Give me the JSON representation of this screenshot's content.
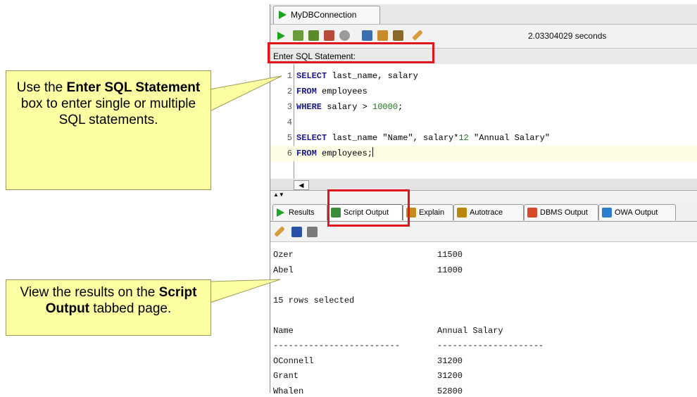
{
  "window": {
    "connection_tab": "MyDBConnection",
    "timing": "2.03304029 seconds"
  },
  "editor": {
    "statement_label": "Enter SQL Statement:",
    "lines": [
      {
        "n": "1",
        "parts": [
          [
            "kw",
            "SELECT"
          ],
          [
            "t",
            " last_name, salary"
          ]
        ]
      },
      {
        "n": "2",
        "parts": [
          [
            "kw",
            "FROM"
          ],
          [
            "t",
            " employees"
          ]
        ]
      },
      {
        "n": "3",
        "parts": [
          [
            "kw",
            "WHERE"
          ],
          [
            "t",
            " salary > "
          ],
          [
            "num",
            "10000"
          ],
          [
            "t",
            ";"
          ]
        ]
      },
      {
        "n": "4",
        "parts": []
      },
      {
        "n": "5",
        "parts": [
          [
            "kw",
            "SELECT"
          ],
          [
            "t",
            " last_name \"Name\", salary*"
          ],
          [
            "num",
            "12"
          ],
          [
            "t",
            " \"Annual Salary\""
          ]
        ]
      },
      {
        "n": "6",
        "parts": [
          [
            "kw",
            "FROM"
          ],
          [
            "t",
            " employees;"
          ]
        ]
      }
    ]
  },
  "output_tabs": [
    {
      "label": "Results",
      "icon": "run-icon",
      "color": "#1da61d"
    },
    {
      "label": "Script Output",
      "icon": "script-icon",
      "color": "#3c8c3c"
    },
    {
      "label": "Explain",
      "icon": "explain-icon",
      "color": "#c98a1c"
    },
    {
      "label": "Autotrace",
      "icon": "autotrace-icon",
      "color": "#b8860b"
    },
    {
      "label": "DBMS Output",
      "icon": "dbms-output-icon",
      "color": "#d64a2a"
    },
    {
      "label": "OWA Output",
      "icon": "owa-output-icon",
      "color": "#2a7dcf"
    }
  ],
  "output": {
    "lines": [
      [
        "Ozer",
        "11500"
      ],
      [
        "Abel",
        "11000"
      ],
      [
        "",
        ""
      ],
      [
        "15 rows selected",
        ""
      ],
      [
        "",
        ""
      ],
      [
        "Name",
        "Annual Salary"
      ],
      [
        "-------------------------",
        "---------------------"
      ],
      [
        "OConnell",
        "31200"
      ],
      [
        "Grant",
        "31200"
      ],
      [
        "Whalen",
        "52800"
      ]
    ]
  },
  "callouts": {
    "top": {
      "prefix": "Use the ",
      "bold": "Enter SQL Statement",
      "suffix": " box to enter single or multiple SQL statements."
    },
    "bottom": {
      "prefix": "View the results on the ",
      "bold": "Script Output",
      "suffix": " tabbed page."
    }
  },
  "colors": {
    "highlight": "#e0161d",
    "callout_bg": "#fefea2",
    "run_green": "#1da61d"
  }
}
